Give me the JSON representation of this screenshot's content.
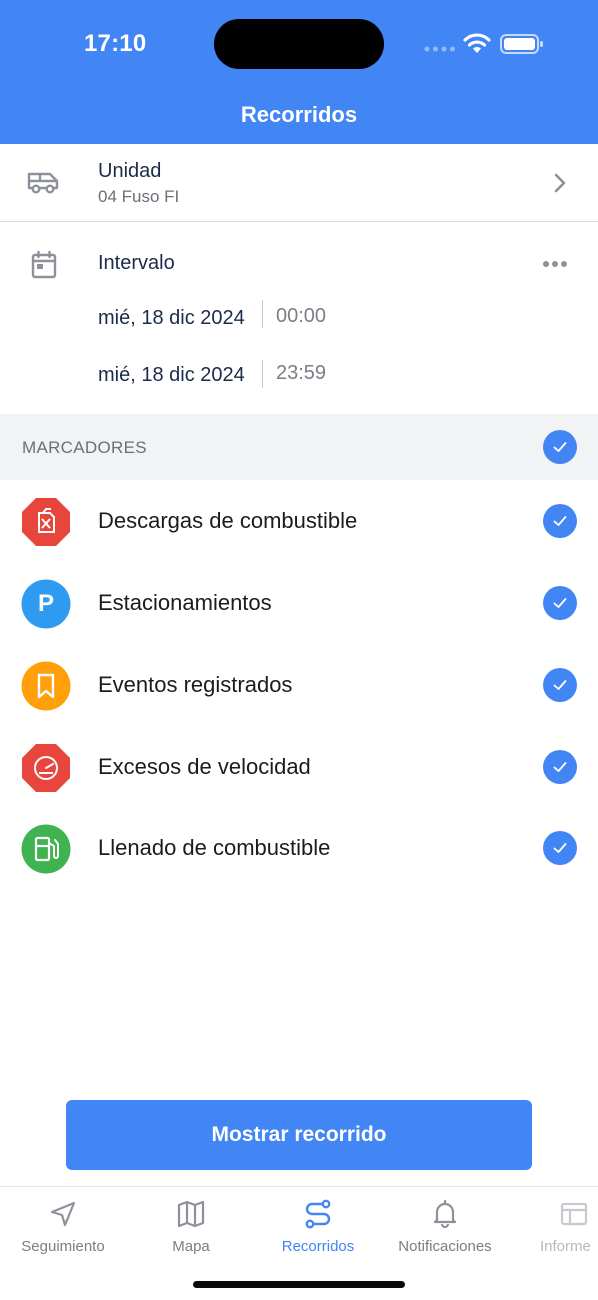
{
  "status_bar": {
    "time": "17:10"
  },
  "header": {
    "title": "Recorridos"
  },
  "unit": {
    "label": "Unidad",
    "value": "04 Fuso FI"
  },
  "interval": {
    "label": "Intervalo",
    "start": {
      "date": "mié, 18 dic 2024",
      "time": "00:00"
    },
    "end": {
      "date": "mié, 18 dic 2024",
      "time": "23:59"
    }
  },
  "markers": {
    "section_label": "MARCADORES",
    "items": [
      {
        "label": "Descargas de combustible",
        "icon": "fuel-drain-icon",
        "color": "#e8453c"
      },
      {
        "label": "Estacionamientos",
        "icon": "parking-icon",
        "color": "#2f9bf0",
        "glyph": "P"
      },
      {
        "label": "Eventos registrados",
        "icon": "bookmark-icon",
        "color": "#ff9f0a"
      },
      {
        "label": "Excesos de velocidad",
        "icon": "speedometer-icon",
        "color": "#e8453c"
      },
      {
        "label": "Llenado de combustible",
        "icon": "fuel-pump-icon",
        "color": "#3fb34f"
      }
    ]
  },
  "actions": {
    "show_route": "Mostrar recorrido"
  },
  "tabs": [
    {
      "label": "Seguimiento"
    },
    {
      "label": "Mapa"
    },
    {
      "label": "Recorridos"
    },
    {
      "label": "Notificaciones"
    },
    {
      "label": "Informe"
    }
  ],
  "colors": {
    "accent": "#4285f4"
  }
}
